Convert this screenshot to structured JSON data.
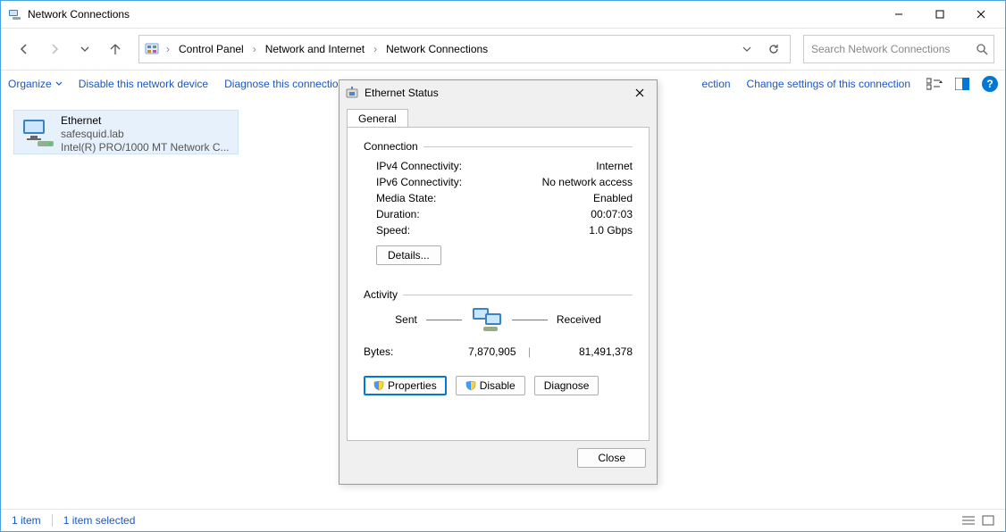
{
  "window": {
    "title": "Network Connections"
  },
  "breadcrumb": {
    "root": "Control Panel",
    "mid": "Network and Internet",
    "leaf": "Network Connections"
  },
  "search": {
    "placeholder": "Search Network Connections"
  },
  "toolbar": {
    "organize": "Organize",
    "disable_device": "Disable this network device",
    "diagnose": "Diagnose this connection",
    "rename_tail": "ection",
    "change_settings": "Change settings of this connection"
  },
  "adapter": {
    "name": "Ethernet",
    "domain": "safesquid.lab",
    "device": "Intel(R) PRO/1000 MT Network C..."
  },
  "dialog": {
    "title": "Ethernet Status",
    "tab_general": "General",
    "group_connection": "Connection",
    "ipv4_label": "IPv4 Connectivity:",
    "ipv4_value": "Internet",
    "ipv6_label": "IPv6 Connectivity:",
    "ipv6_value": "No network access",
    "media_label": "Media State:",
    "media_value": "Enabled",
    "duration_label": "Duration:",
    "duration_value": "00:07:03",
    "speed_label": "Speed:",
    "speed_value": "1.0 Gbps",
    "details_btn": "Details...",
    "group_activity": "Activity",
    "sent_label": "Sent",
    "received_label": "Received",
    "bytes_label": "Bytes:",
    "bytes_sent": "7,870,905",
    "bytes_received": "81,491,378",
    "properties_btn": "Properties",
    "disable_btn": "Disable",
    "diagnose_btn": "Diagnose",
    "close_btn": "Close"
  },
  "status": {
    "count": "1 item",
    "selected": "1 item selected"
  }
}
